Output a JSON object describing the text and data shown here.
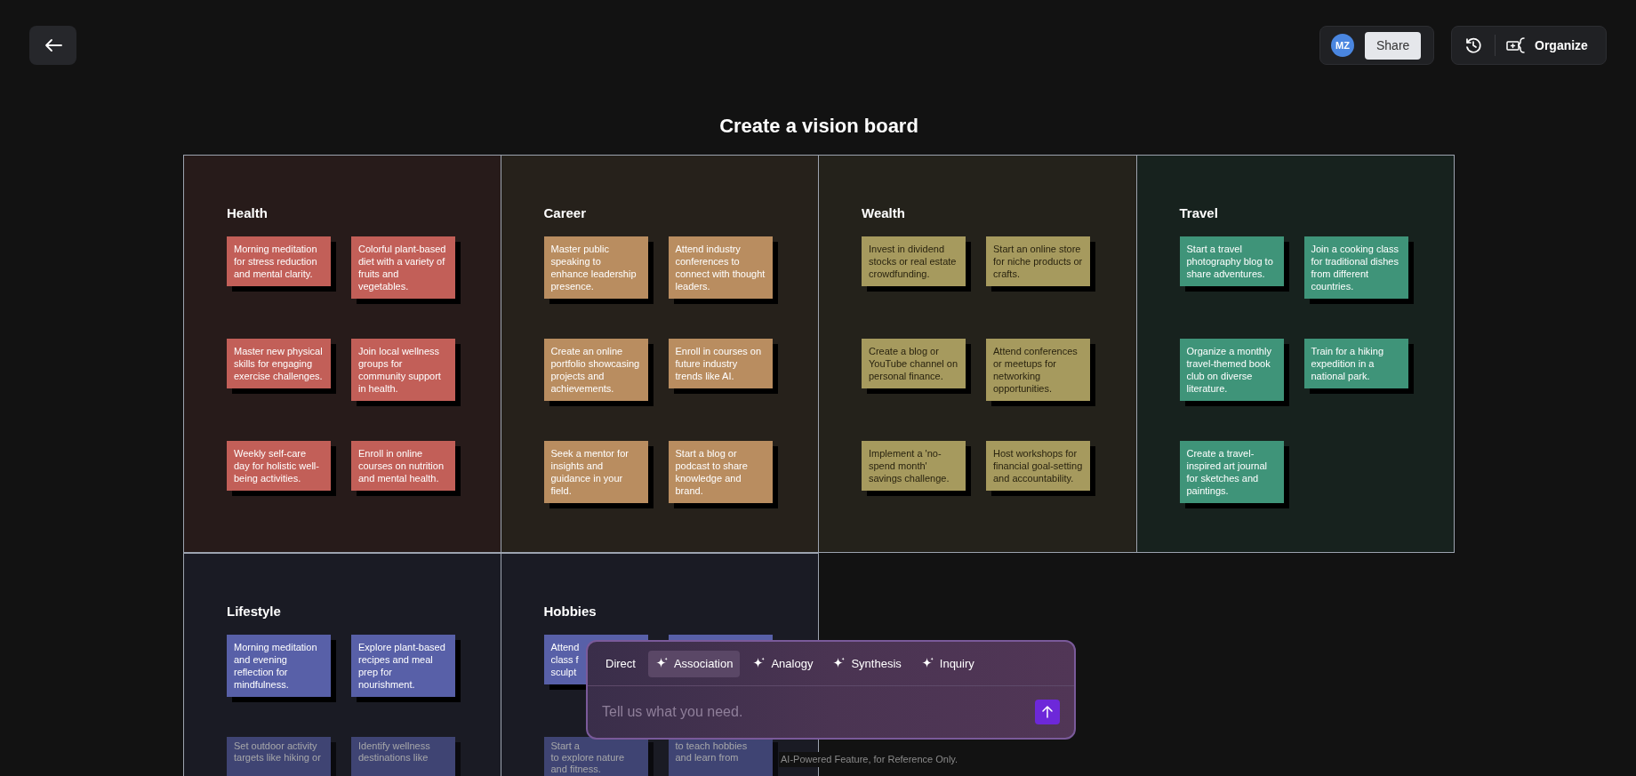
{
  "top_bar": {
    "avatar": {
      "initials": "MZ"
    },
    "share_button": "Share",
    "organize_button": "Organize"
  },
  "title": "Create a vision board",
  "categories": [
    {
      "name": "Health",
      "color": "#c25f58",
      "dark_text": false,
      "notes": [
        {
          "text": "Morning meditation for stress reduction and mental clarity.",
          "faded": false
        },
        {
          "text": "Colorful plant-based diet with a variety of fruits and vegetables.",
          "faded": false
        },
        {
          "text": "Master new physical skills for engaging exercise challenges.",
          "faded": false
        },
        {
          "text": "Join local wellness groups for community support in health.",
          "faded": false
        },
        {
          "text": "Weekly self-care day for holistic well-being activities.",
          "faded": false
        },
        {
          "text": "Enroll in online courses on nutrition and mental health.",
          "faded": false
        }
      ]
    },
    {
      "name": "Career",
      "color": "#b98d60",
      "dark_text": false,
      "notes": [
        {
          "text": "Master public speaking to enhance leadership presence.",
          "faded": false
        },
        {
          "text": "Attend industry conferences to connect with thought leaders.",
          "faded": false
        },
        {
          "text": "Create an online portfolio showcasing projects and achievements.",
          "faded": false
        },
        {
          "text": "Enroll in courses on future industry trends like AI.",
          "faded": false
        },
        {
          "text": "Seek a mentor for insights and guidance in your field.",
          "faded": false
        },
        {
          "text": "Start a blog or podcast to share knowledge and brand.",
          "faded": false
        }
      ]
    },
    {
      "name": "Wealth",
      "color": "#a69a5e",
      "dark_text": true,
      "notes": [
        {
          "text": "Invest in dividend stocks or real estate crowdfunding.",
          "faded": false
        },
        {
          "text": "Start an online store for niche products or crafts.",
          "faded": false
        },
        {
          "text": "Create a blog or YouTube channel on personal finance.",
          "faded": false
        },
        {
          "text": "Attend conferences or meetups for networking opportunities.",
          "faded": false
        },
        {
          "text": "Implement a 'no-spend month' savings challenge.",
          "faded": false
        },
        {
          "text": "Host workshops for financial goal-setting and accountability.",
          "faded": false
        }
      ]
    },
    {
      "name": "Travel",
      "color": "#3f9479",
      "dark_text": false,
      "notes": [
        {
          "text": "Start a travel photography blog to share adventures.",
          "faded": false
        },
        {
          "text": "Join a cooking class for traditional dishes from different countries.",
          "faded": false
        },
        {
          "text": "Organize a monthly travel-themed book club on diverse literature.",
          "faded": false
        },
        {
          "text": "Train for a hiking expedition in a national park.",
          "faded": false
        },
        {
          "text": "Create a travel-inspired art journal for sketches and paintings.",
          "faded": false
        }
      ]
    },
    {
      "name": "Lifestyle",
      "color": "#5860a8",
      "dark_text": false,
      "notes": [
        {
          "text": "Morning meditation and evening reflection for mindfulness.",
          "faded": false
        },
        {
          "text": "Explore plant-based recipes and meal prep for nourishment.",
          "faded": false
        },
        {
          "lines": [
            "Set outdoor activity",
            "targets like hiking or"
          ],
          "faded": true
        },
        {
          "lines": [
            "Identify wellness",
            "destinations like"
          ],
          "faded": true
        }
      ]
    },
    {
      "name": "Hobbies",
      "color": "#5860a8",
      "dark_text": false,
      "notes": [
        {
          "lines": [
            "Attend",
            "class f",
            "sculpt"
          ],
          "faded": false
        },
        {
          "faded": false
        },
        {
          "lines": [
            "Start a",
            "to explore nature",
            "and fitness."
          ],
          "faded": true
        },
        {
          "lines": [
            "to teach hobbies",
            "and learn from"
          ],
          "faded": true
        }
      ]
    }
  ],
  "prompt_panel": {
    "modes": [
      {
        "label": "Direct",
        "kind": "plain",
        "selected": false
      },
      {
        "label": "Association",
        "kind": "sparkle",
        "selected": true
      },
      {
        "label": "Analogy",
        "kind": "sparkle",
        "selected": false
      },
      {
        "label": "Synthesis",
        "kind": "sparkle",
        "selected": false
      },
      {
        "label": "Inquiry",
        "kind": "sparkle",
        "selected": false
      }
    ],
    "input": {
      "placeholder": "Tell us what you need."
    }
  },
  "footer_note": "AI-Powered Feature, for Reference Only."
}
